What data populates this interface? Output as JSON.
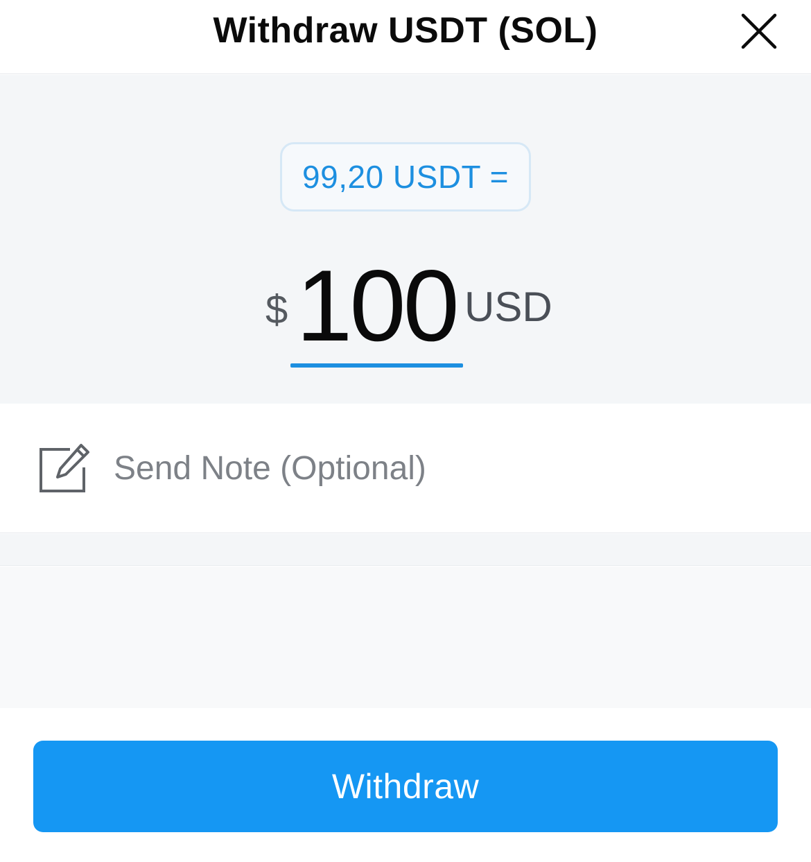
{
  "header": {
    "title": "Withdraw USDT (SOL)",
    "close_icon": "close-icon"
  },
  "amount": {
    "conversion_text": "99,20 USDT =",
    "currency_symbol": "$",
    "value": "100",
    "currency_code": "USD"
  },
  "note": {
    "icon": "edit-note-icon",
    "placeholder": "Send Note (Optional)"
  },
  "footer": {
    "withdraw_label": "Withdraw"
  },
  "colors": {
    "accent": "#1597f3",
    "link_blue": "#1d8fe0",
    "panel_bg": "#f4f6f8"
  }
}
